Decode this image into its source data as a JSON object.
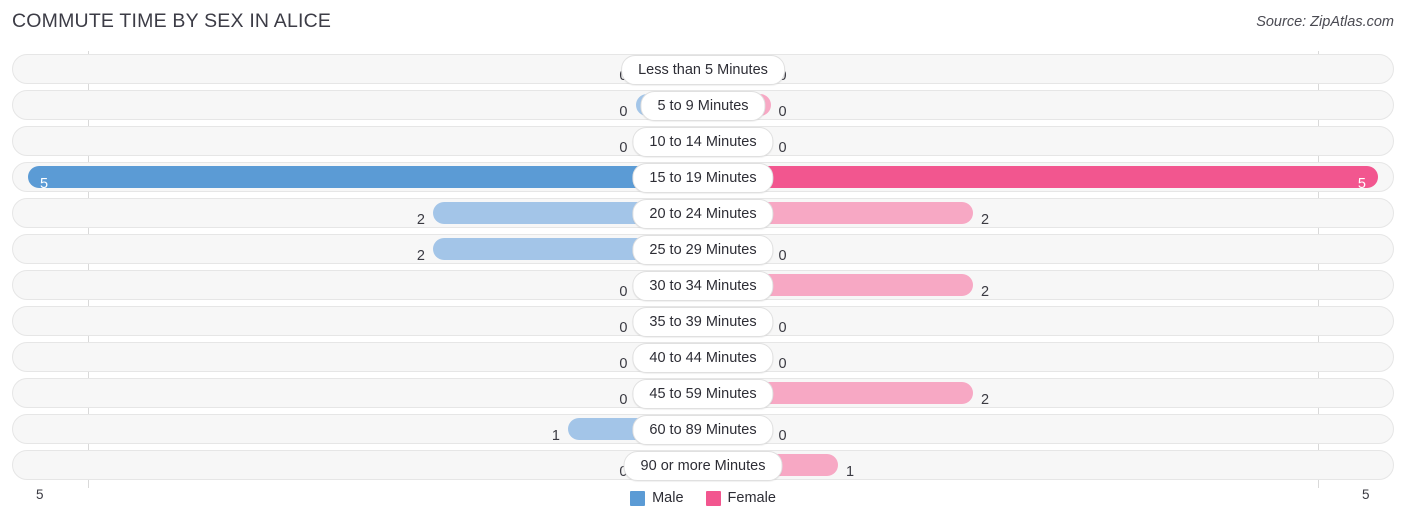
{
  "header": {
    "title": "COMMUTE TIME BY SEX IN ALICE",
    "source": "Source: ZipAtlas.com"
  },
  "axis": {
    "left_tick": "5",
    "right_tick": "5"
  },
  "legend": {
    "items": [
      {
        "label": "Male",
        "color": "#5b9bd5"
      },
      {
        "label": "Female",
        "color": "#f2568f"
      }
    ]
  },
  "colors": {
    "male_light": "#a3c5e8",
    "male_strong": "#5b9bd5",
    "female_light": "#f7a8c4",
    "female_strong": "#f2568f",
    "track": "#f7f7f7"
  },
  "chart_data": {
    "type": "bar",
    "orientation": "horizontal-diverging",
    "title": "COMMUTE TIME BY SEX IN ALICE",
    "xlabel": "",
    "ylabel": "",
    "xlim": [
      5,
      5
    ],
    "grid": false,
    "legend_position": "bottom-center",
    "categories": [
      "Less than 5 Minutes",
      "5 to 9 Minutes",
      "10 to 14 Minutes",
      "15 to 19 Minutes",
      "20 to 24 Minutes",
      "25 to 29 Minutes",
      "30 to 34 Minutes",
      "35 to 39 Minutes",
      "40 to 44 Minutes",
      "45 to 59 Minutes",
      "60 to 89 Minutes",
      "90 or more Minutes"
    ],
    "series": [
      {
        "name": "Male",
        "values": [
          0,
          0,
          0,
          5,
          2,
          2,
          0,
          0,
          0,
          0,
          1,
          0
        ]
      },
      {
        "name": "Female",
        "values": [
          0,
          0,
          0,
          5,
          2,
          0,
          2,
          0,
          0,
          2,
          0,
          1
        ]
      }
    ],
    "max_value": 5
  },
  "rows": [
    {
      "label": "Less than 5 Minutes",
      "male": "0",
      "female": "0",
      "male_pct": 0,
      "female_pct": 0,
      "max": false
    },
    {
      "label": "5 to 9 Minutes",
      "male": "0",
      "female": "0",
      "male_pct": 0,
      "female_pct": 0,
      "max": false
    },
    {
      "label": "10 to 14 Minutes",
      "male": "0",
      "female": "0",
      "male_pct": 0,
      "female_pct": 0,
      "max": false
    },
    {
      "label": "15 to 19 Minutes",
      "male": "5",
      "female": "5",
      "male_pct": 100,
      "female_pct": 100,
      "max": true
    },
    {
      "label": "20 to 24 Minutes",
      "male": "2",
      "female": "2",
      "male_pct": 40,
      "female_pct": 40,
      "max": false
    },
    {
      "label": "25 to 29 Minutes",
      "male": "2",
      "female": "0",
      "male_pct": 40,
      "female_pct": 0,
      "max": false
    },
    {
      "label": "30 to 34 Minutes",
      "male": "0",
      "female": "2",
      "male_pct": 0,
      "female_pct": 40,
      "max": false
    },
    {
      "label": "35 to 39 Minutes",
      "male": "0",
      "female": "0",
      "male_pct": 0,
      "female_pct": 0,
      "max": false
    },
    {
      "label": "40 to 44 Minutes",
      "male": "0",
      "female": "0",
      "male_pct": 0,
      "female_pct": 0,
      "max": false
    },
    {
      "label": "45 to 59 Minutes",
      "male": "0",
      "female": "2",
      "male_pct": 0,
      "female_pct": 40,
      "max": false
    },
    {
      "label": "60 to 89 Minutes",
      "male": "1",
      "female": "0",
      "male_pct": 20,
      "female_pct": 0,
      "max": false
    },
    {
      "label": "90 or more Minutes",
      "male": "0",
      "female": "1",
      "male_pct": 0,
      "female_pct": 20,
      "max": false
    }
  ]
}
